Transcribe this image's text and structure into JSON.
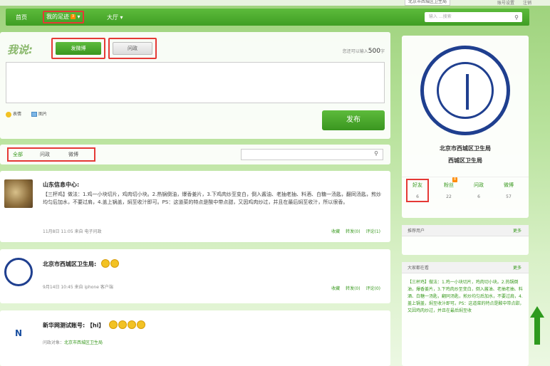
{
  "topbar": {
    "region": "北京市西城区卫生局",
    "link1": "账号设置",
    "link2": "注销"
  },
  "nav": {
    "home": "首页",
    "mine": "我的足迹",
    "mine_badge": "3",
    "hall": "大厅 ▾",
    "search_placeholder": "输入 ...搜索"
  },
  "composer": {
    "logo": "我说:",
    "tab_weibo": "发微博",
    "tab_ask": "问政",
    "counter_prefix": "您还可以输入",
    "counter_value": "500",
    "counter_suffix": "字",
    "emoji_label": "表情",
    "image_label": "图片",
    "publish": "发布"
  },
  "filters": {
    "all": "全部",
    "ask": "问政",
    "weibo": "微博"
  },
  "posts": [
    {
      "author": "山东信息中心:",
      "content": "【三杯鸡】做法：1.鸡一小块切片，鸡肉切小块。2.热锅倒油，爆香姜片，3.下鸡肉炒至变白，倒入酱油、老抽老抽、料酒、白糖一汤匙，翻同汤匙，煎炒均匀后加水，不要过肩，4.盖上锅盖，焖至收汁即可。PS：这道菜的特点是酸中带点甜，又因鸡肉炒过，并且在最后焖至收汁，所以很香。",
      "meta": "11月8日 11:05 来自 电子问政",
      "fav": "收藏",
      "forward": "转发(0)",
      "comment": "评论(1)"
    },
    {
      "author": "北京市西城区卫生局:",
      "meta": "9月14日 10:45 来自 iphone 客户端",
      "fav": "收藏",
      "forward": "转发(0)",
      "comment": "评论(0)"
    },
    {
      "author": "新华网测试账号:",
      "tag": "【hi】",
      "meta_prefix": "问政对象：",
      "meta_target": "北京市西城区卫生局",
      "avatar_text": "N"
    }
  ],
  "profile": {
    "name1": "北京市西城区卫生局",
    "name2": "西城区卫生局",
    "stats": [
      {
        "label": "好友",
        "num": "6"
      },
      {
        "label": "粉丝",
        "num": "22",
        "badge": "8"
      },
      {
        "label": "问政",
        "num": "6"
      },
      {
        "label": "微博",
        "num": "57"
      }
    ]
  },
  "recommend": {
    "title": "推荐用户",
    "more": "更多"
  },
  "hot": {
    "title": "大家都在看",
    "more": "更多",
    "text": "【三杯鸡】做法：1.鸡一小块切片，鸡肉切小块。2.热锅倒油，爆香姜片，3.下鸡肉炒至变白，倒入酱油、老抽老抽、料酒、白糖一汤匙，翻同汤匙，煎炒均匀后加水，不要过肩，4.盖上锅盖，焖至收汁即可。PS：这道菜的特点是酸中带点甜，又因鸡肉炒过，并且在最后焖至收"
  }
}
